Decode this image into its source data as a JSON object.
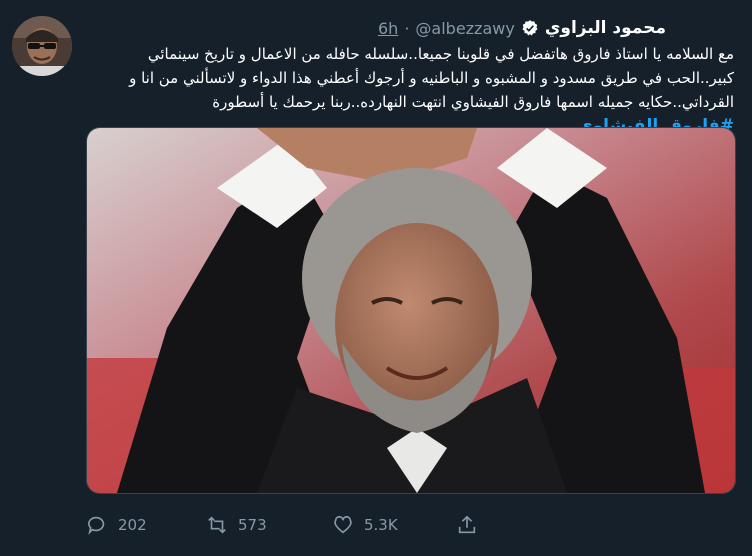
{
  "tweet": {
    "display_name": "محمود البزاوي",
    "handle": "@albezzawy",
    "separator": "·",
    "time": "6h",
    "text_main": "مع السلامه يا استاذ فاروق هاتفضل في قلوبنا جميعا..سلسله حافله من الاعمال و تاريخ سينمائي كبير..الحب في طريق مسدود و المشبوه و الباطنيه و أرجوك أعطني هذا الدواء و لاتسألني من انا و القرداتي..حكايه جميله اسمها فاروق الفيشاوي انتهت النهارده..ربنا يرحمك يا أسطورة ",
    "hashtag": "#فاروق_الفيشاوي"
  },
  "actions": {
    "reply_count": "202",
    "retweet_count": "573",
    "like_count": "5.3K"
  },
  "colors": {
    "background": "#15202b",
    "text_secondary": "#8899a6",
    "accent": "#1da1f2"
  },
  "icons": [
    "chevron-down-icon",
    "verified-badge-icon",
    "reply-icon",
    "retweet-icon",
    "like-icon",
    "share-icon"
  ]
}
